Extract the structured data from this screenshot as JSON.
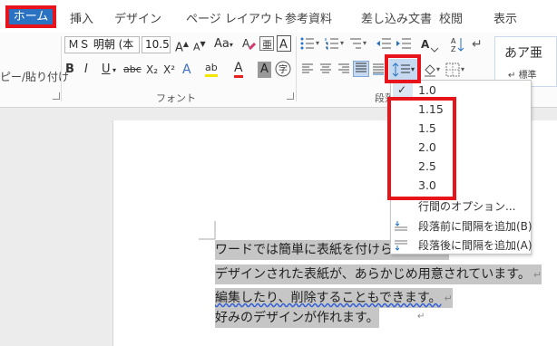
{
  "tabs": {
    "home": "ホーム",
    "insert": "挿入",
    "design": "デザイン",
    "layout": "ページ レイアウト",
    "references": "参考資料",
    "mailings": "差し込み文書",
    "review": "校閲",
    "view": "表示"
  },
  "ribbon": {
    "clipboard": {
      "paste_label": "ピー/貼り付け"
    },
    "font": {
      "font_name": "ＭＳ 明朝 (本",
      "font_size": "10.5",
      "group_label": "フォント",
      "grow_label": "A",
      "shrink_label": "A",
      "case_label": "Aa",
      "clear_label": "A",
      "bold_label": "B",
      "italic_label": "I",
      "underline_label": "U",
      "strike_label": "abc",
      "sub_label": "X₂",
      "sup_label": "X²",
      "effects_label": "A",
      "highlight_label": "ab",
      "color_label": "A",
      "shading_label": "A",
      "enclose_label": "字"
    },
    "paragraph": {
      "group_label": "段落"
    },
    "styles": {
      "sample": "あア亜",
      "name": "標準"
    }
  },
  "line_spacing_menu": {
    "options": [
      "1.0",
      "1.15",
      "1.5",
      "2.0",
      "2.5",
      "3.0"
    ],
    "selected": "1.0",
    "more_options": "行間のオプション...",
    "add_before": "段落前に間隔を追加(B)",
    "add_after": "段落後に間隔を追加(A)"
  },
  "document": {
    "lines": [
      "ワードでは簡単に表紙を付けられます。",
      "デザインされた表紙が、あらかじめ用意されています。",
      "編集したり、削除することもできます。",
      "好みのデザインが作れます。"
    ],
    "paragraph_mark": "↵"
  },
  "colors": {
    "highlight_red": "#e8141c",
    "active_tab_blue": "#2a73c2",
    "selection_gray": "#c6c6c6"
  }
}
